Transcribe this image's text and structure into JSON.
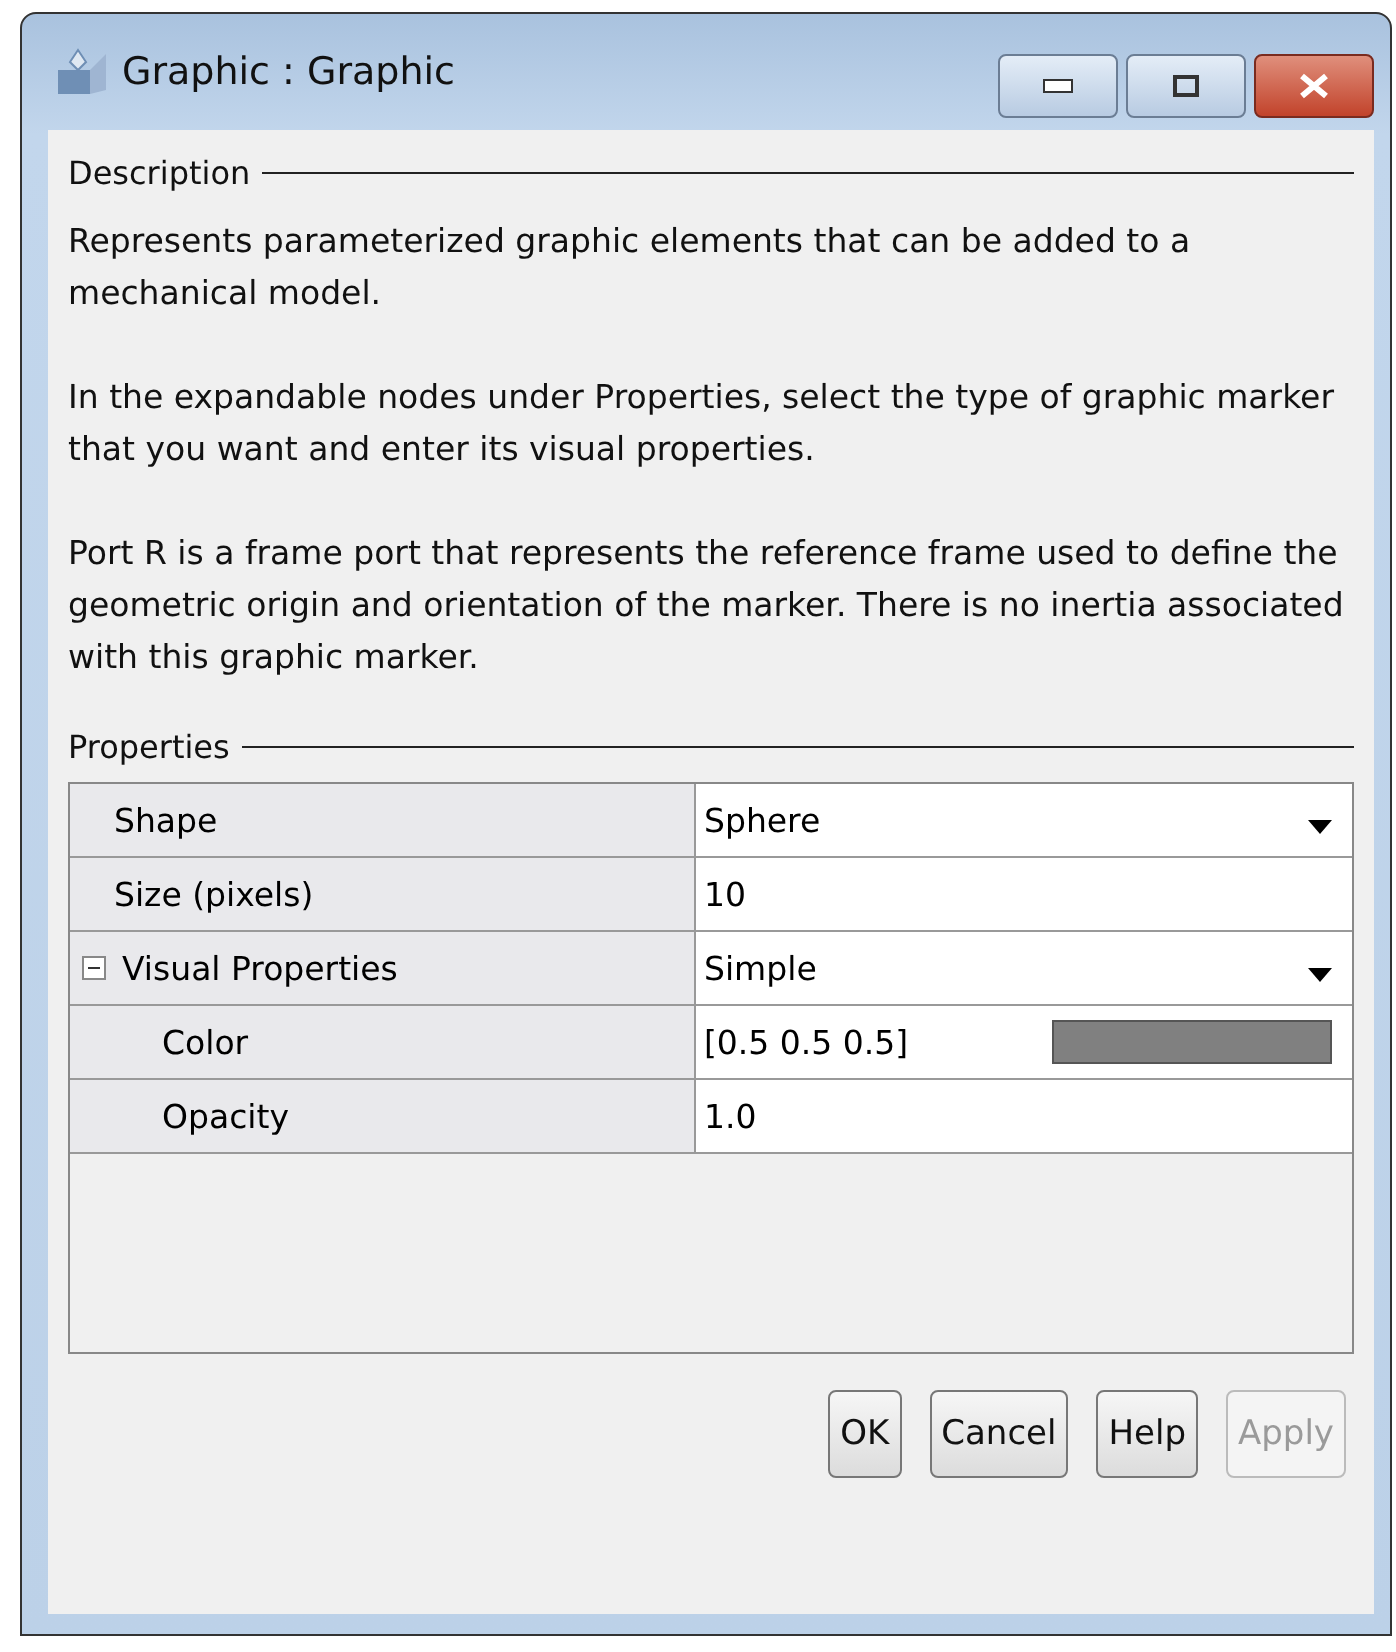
{
  "window": {
    "title": "Graphic : Graphic"
  },
  "description": {
    "heading": "Description",
    "paragraphs": [
      "Represents parameterized graphic elements that can be added to a mechanical model.",
      "In the expandable nodes under Properties, select the type of graphic marker that you want and enter its visual properties.",
      "Port R is a frame port that represents the reference frame used to define the geometric origin and orientation of the marker. There is no inertia associated with this graphic marker."
    ]
  },
  "properties": {
    "heading": "Properties",
    "rows": [
      {
        "label": "Shape",
        "value": "Sphere",
        "kind": "dropdown"
      },
      {
        "label": "Size (pixels)",
        "value": "10",
        "kind": "text"
      },
      {
        "label": "Visual Properties",
        "value": "Simple",
        "kind": "dropdown",
        "expanded": true,
        "children": [
          {
            "label": "Color",
            "value": "[0.5 0.5 0.5]",
            "kind": "color",
            "color": "#808080"
          },
          {
            "label": "Opacity",
            "value": "1.0",
            "kind": "text"
          }
        ]
      }
    ]
  },
  "buttons": [
    {
      "label": "OK",
      "disabled": false
    },
    {
      "label": "Cancel",
      "disabled": false
    },
    {
      "label": "Help",
      "disabled": false
    },
    {
      "label": "Apply",
      "disabled": true
    }
  ]
}
